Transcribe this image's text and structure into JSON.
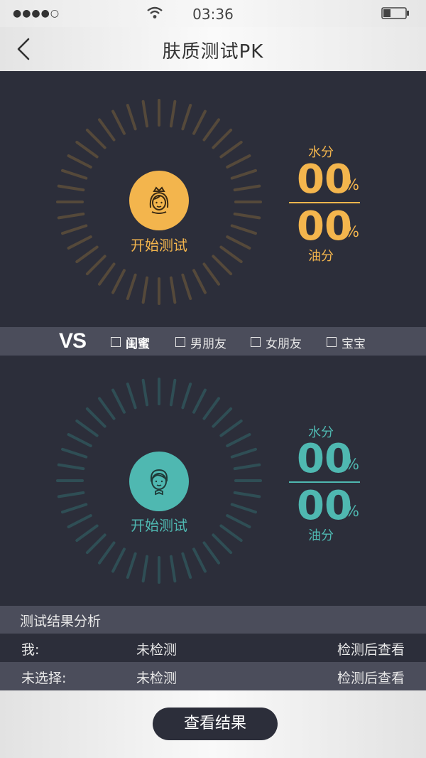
{
  "status": {
    "signal": "●●●●○",
    "time": "03:36"
  },
  "nav": {
    "title": "肤质测试PK"
  },
  "colors": {
    "gold": "#f3b54d",
    "teal": "#4fb8b1",
    "bg": "#2c2e3a",
    "bar": "#4b4d5b"
  },
  "me": {
    "start_label": "开始测试",
    "water_label": "水分",
    "water_value": "00",
    "water_unit": "%",
    "oil_label": "油分",
    "oil_value": "00",
    "oil_unit": "%"
  },
  "vs": {
    "label": "VS",
    "options": [
      {
        "label": "闺蜜",
        "selected": true
      },
      {
        "label": "男朋友",
        "selected": false
      },
      {
        "label": "女朋友",
        "selected": false
      },
      {
        "label": "宝宝",
        "selected": false
      }
    ]
  },
  "other": {
    "start_label": "开始测试",
    "water_label": "水分",
    "water_value": "00",
    "water_unit": "%",
    "oil_label": "油分",
    "oil_value": "00",
    "oil_unit": "%"
  },
  "analysis": {
    "title": "测试结果分析",
    "rows": [
      {
        "who": "我:",
        "status": "未检测",
        "action": "检测后查看"
      },
      {
        "who": "未选择:",
        "status": "未检测",
        "action": "检测后查看"
      }
    ]
  },
  "footer": {
    "button_label": "查看结果"
  }
}
